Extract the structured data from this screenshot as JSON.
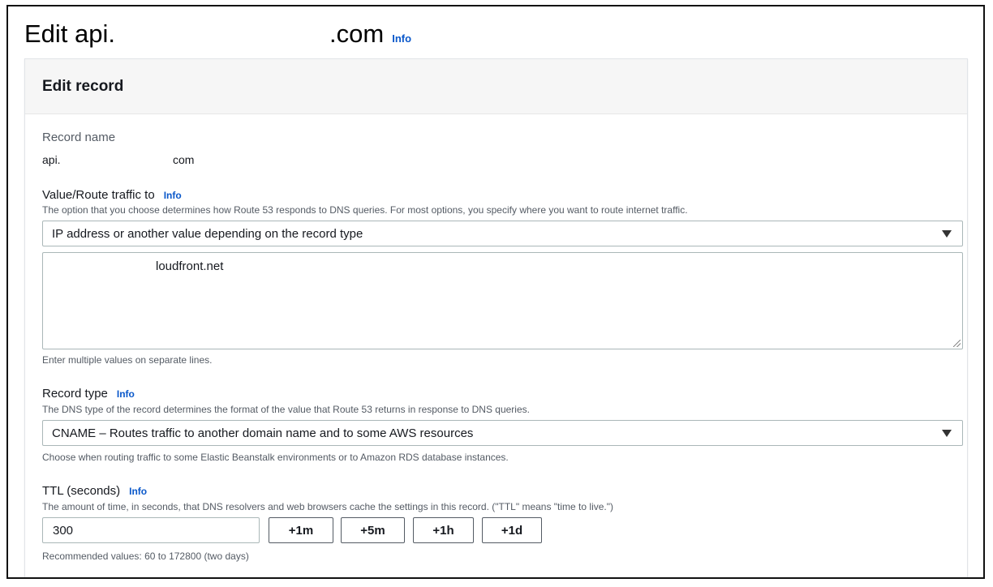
{
  "page": {
    "title_prefix": "Edit api.",
    "title_suffix": ".com",
    "info_label": "Info"
  },
  "panel": {
    "title": "Edit record"
  },
  "record_name": {
    "label": "Record name",
    "value_prefix": "api.",
    "value_suffix": "com"
  },
  "route": {
    "label": "Value/Route traffic to",
    "info_label": "Info",
    "description": "The option that you choose determines how Route 53 responds to DNS queries. For most options, you specify where you want to route internet traffic.",
    "selected": "IP address or another value depending on the record type",
    "value_text": "loudfront.net",
    "hint": "Enter multiple values on separate lines."
  },
  "record_type": {
    "label": "Record type",
    "info_label": "Info",
    "description": "The DNS type of the record determines the format of the value that Route 53 returns in response to DNS queries.",
    "selected": "CNAME – Routes traffic to another domain name and to some AWS resources",
    "hint": "Choose when routing traffic to some Elastic Beanstalk environments or to Amazon RDS database instances."
  },
  "ttl": {
    "label": "TTL (seconds)",
    "info_label": "Info",
    "description": "The amount of time, in seconds, that DNS resolvers and web browsers cache the settings in this record. (\"TTL\" means \"time to live.\")",
    "value": "300",
    "buttons": [
      "+1m",
      "+5m",
      "+1h",
      "+1d"
    ],
    "hint": "Recommended values: 60 to 172800 (two days)"
  }
}
